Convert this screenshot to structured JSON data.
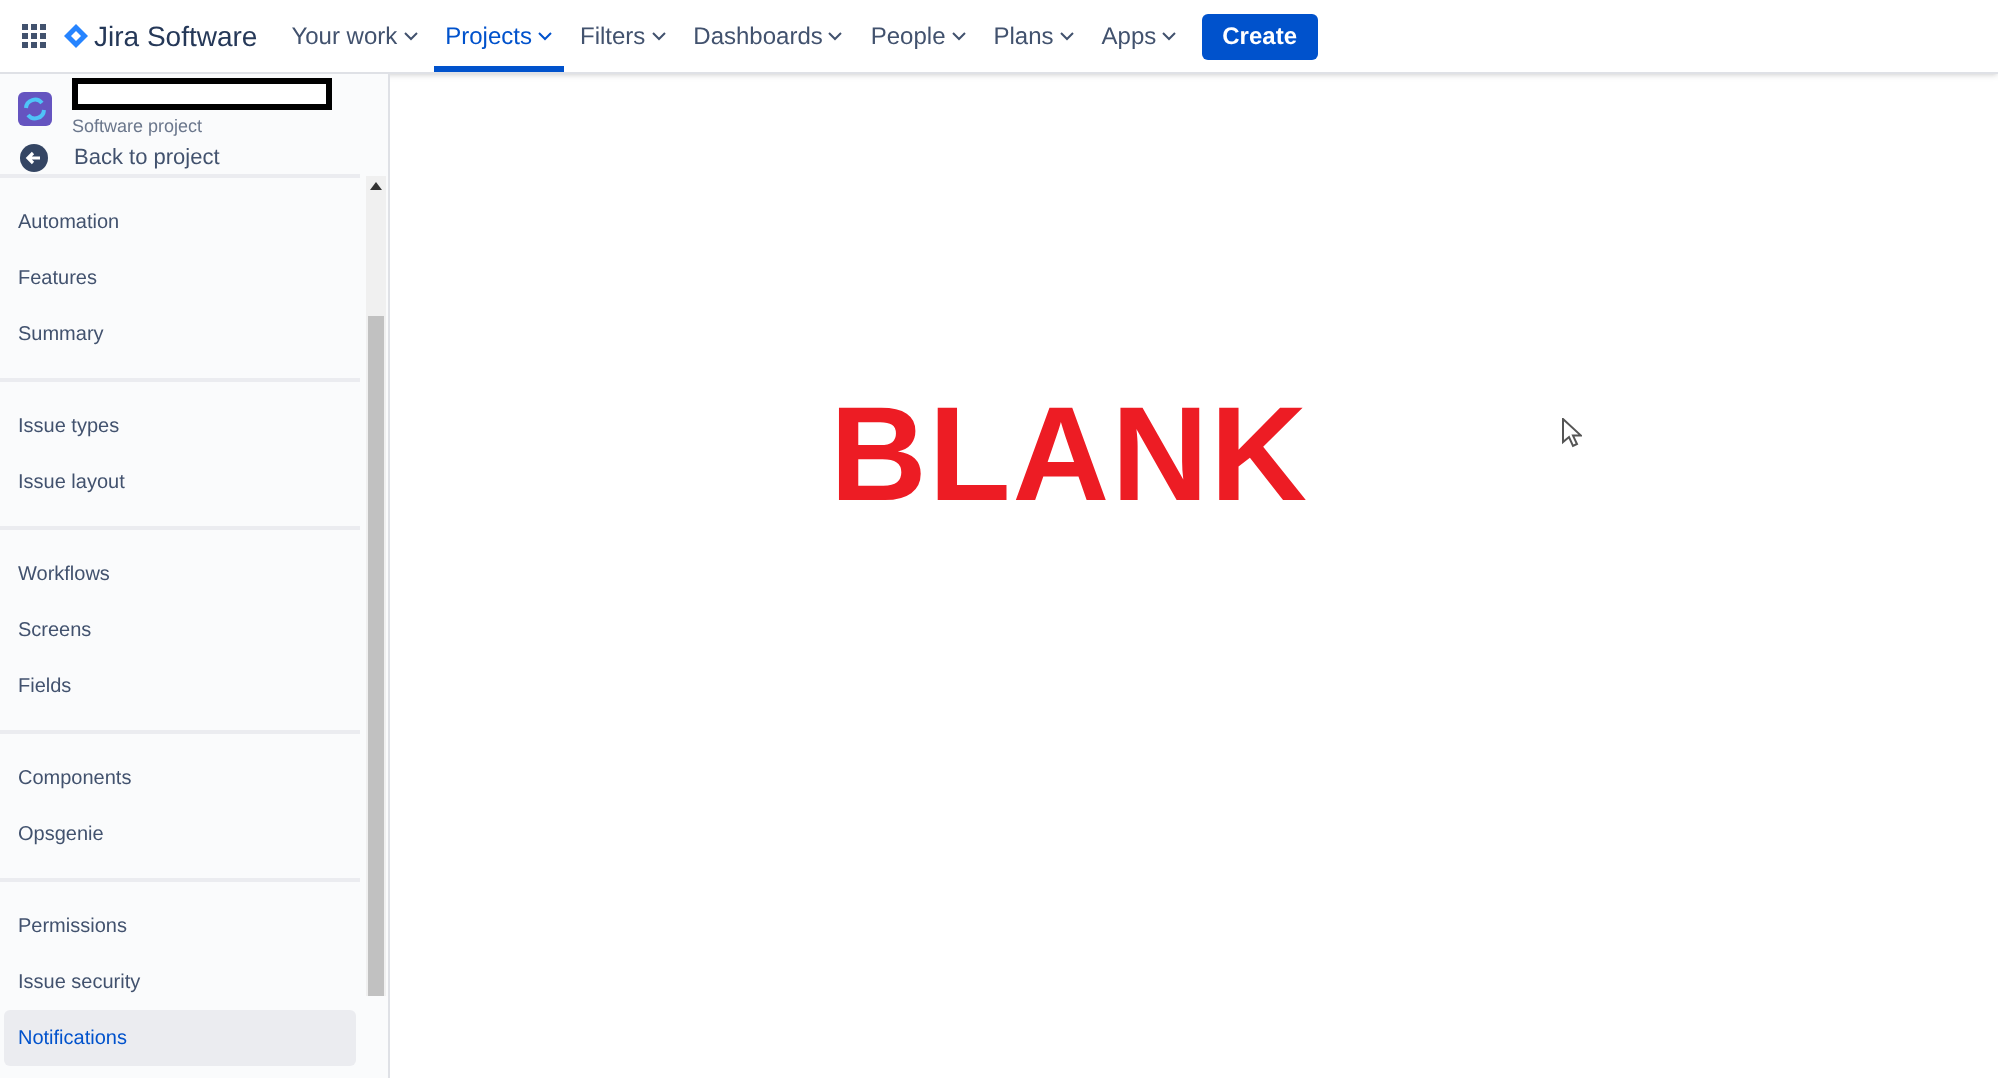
{
  "top_nav": {
    "product": "Jira Software",
    "menus": [
      {
        "label": "Your work",
        "selected": false
      },
      {
        "label": "Projects",
        "selected": true
      },
      {
        "label": "Filters",
        "selected": false
      },
      {
        "label": "Dashboards",
        "selected": false
      },
      {
        "label": "People",
        "selected": false
      },
      {
        "label": "Plans",
        "selected": false
      },
      {
        "label": "Apps",
        "selected": false
      }
    ],
    "create": "Create"
  },
  "sidebar": {
    "project_type": "Software project",
    "back": "Back to project",
    "groups": [
      [
        {
          "label": "Automation",
          "selected": false
        },
        {
          "label": "Features",
          "selected": false
        },
        {
          "label": "Summary",
          "selected": false
        }
      ],
      [
        {
          "label": "Issue types",
          "selected": false
        },
        {
          "label": "Issue layout",
          "selected": false
        }
      ],
      [
        {
          "label": "Workflows",
          "selected": false
        },
        {
          "label": "Screens",
          "selected": false
        },
        {
          "label": "Fields",
          "selected": false
        }
      ],
      [
        {
          "label": "Components",
          "selected": false
        },
        {
          "label": "Opsgenie",
          "selected": false
        }
      ],
      [
        {
          "label": "Permissions",
          "selected": false
        },
        {
          "label": "Issue security",
          "selected": false
        },
        {
          "label": "Notifications",
          "selected": true
        }
      ]
    ]
  },
  "main": {
    "annotation": "BLANK"
  }
}
